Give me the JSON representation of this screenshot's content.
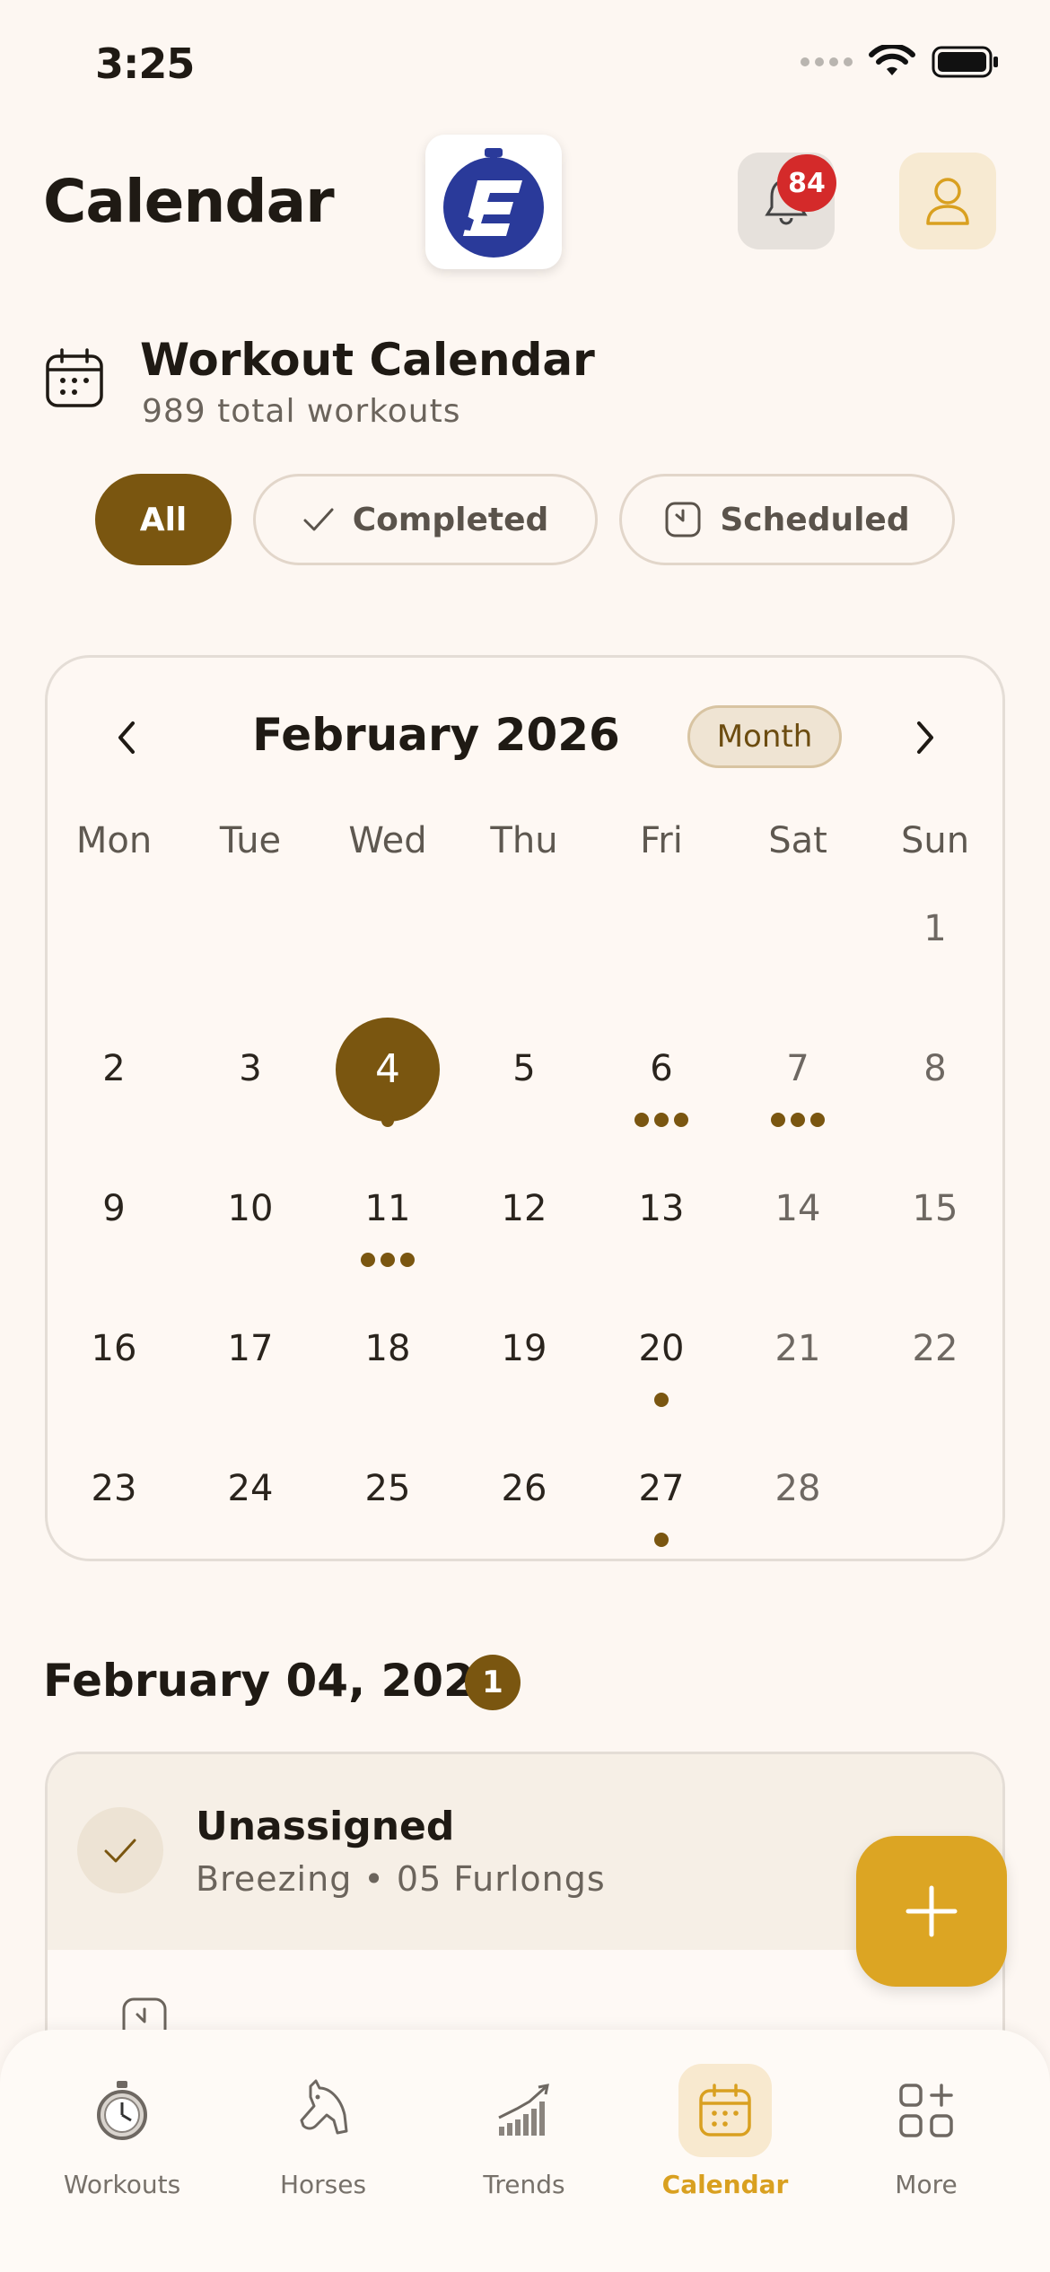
{
  "status_bar": {
    "time": "3:25"
  },
  "header": {
    "title": "Calendar",
    "notification_count": "84"
  },
  "section": {
    "title": "Workout Calendar",
    "subtitle": "989 total workouts"
  },
  "filters": {
    "all": "All",
    "completed": "Completed",
    "scheduled": "Scheduled",
    "selected": "All"
  },
  "calendar": {
    "month_title": "February 2026",
    "view_mode": "Month",
    "weekdays": [
      "Mon",
      "Tue",
      "Wed",
      "Thu",
      "Fri",
      "Sat",
      "Sun"
    ],
    "selected_day": "4",
    "days": {
      "d1": "1",
      "d2": "2",
      "d3": "3",
      "d4": "4",
      "d5": "5",
      "d6": "6",
      "d7": "7",
      "d8": "8",
      "d9": "9",
      "d10": "10",
      "d11": "11",
      "d12": "12",
      "d13": "13",
      "d14": "14",
      "d15": "15",
      "d16": "16",
      "d17": "17",
      "d18": "18",
      "d19": "19",
      "d20": "20",
      "d21": "21",
      "d22": "22",
      "d23": "23",
      "d24": "24",
      "d25": "25",
      "d26": "26",
      "d27": "27",
      "d28": "28"
    },
    "workout_dots": {
      "4": 1,
      "6": 3,
      "7": 3,
      "11": 3,
      "20": 1,
      "27": 1
    }
  },
  "day_detail": {
    "date": "February 04, 2026",
    "count": "1"
  },
  "workout": {
    "title": "Unassigned",
    "subtitle": "Breezing • 05 Furlongs"
  },
  "bottom_nav": {
    "items": [
      "Workouts",
      "Horses",
      "Trends",
      "Calendar",
      "More"
    ],
    "active": "Calendar"
  },
  "colors": {
    "accent_brown": "#7A5610",
    "accent_gold": "#DCA523",
    "badge_red": "#D42A2A",
    "background": "#FDF7F2"
  },
  "icons": [
    "wifi-icon",
    "battery-icon",
    "app-logo",
    "bell-icon",
    "profile-icon",
    "calendar-icon",
    "check-icon",
    "clock-icon",
    "chevron-left-icon",
    "chevron-right-icon",
    "plus-icon",
    "stopwatch-icon",
    "horse-icon",
    "trends-icon",
    "grid-plus-icon"
  ]
}
